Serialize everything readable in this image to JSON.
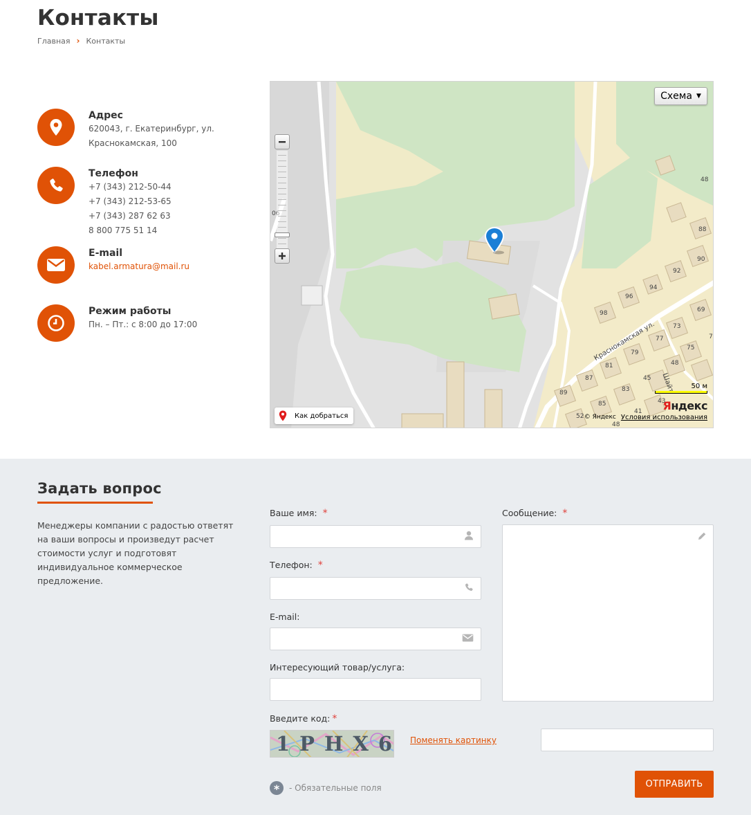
{
  "page": {
    "title": "Контакты",
    "breadcrumb": [
      "Главная",
      "Контакты"
    ]
  },
  "contacts": {
    "address": {
      "title": "Адрес",
      "lines": [
        "620043, г. Екатеринбург, ул.",
        "Краснокамская, 100"
      ],
      "icon": "map-pin-icon"
    },
    "phone": {
      "title": "Телефон",
      "lines": [
        "+7 (343) 212-50-44",
        "+7 (343) 212-53-65",
        "+7 (343) 287 62 63",
        "8 800 775 51 14"
      ],
      "icon": "phone-icon"
    },
    "email": {
      "title": "E-mail",
      "value": "kabel.armatura@mail.ru",
      "icon": "envelope-icon"
    },
    "hours": {
      "title": "Режим работы",
      "value": "Пн. – Пт.: с 8:00 до 17:00",
      "icon": "clock-icon"
    }
  },
  "map": {
    "type_button": "Схема",
    "route_button": "Как добраться",
    "copyright": "© Яндекс",
    "terms": "Условия использования",
    "logo_ya": "Я",
    "logo_rest": "ндекс",
    "scale_label": "50 м",
    "street": "Краснокамская ул.",
    "street2": "Шайт",
    "houses": [
      "48",
      "88",
      "90",
      "92",
      "94",
      "96",
      "98",
      "69",
      "73",
      "77",
      "75",
      "79",
      "81",
      "87",
      "89",
      "85",
      "83",
      "45",
      "43",
      "41",
      "48",
      "52",
      "48",
      "7",
      "06"
    ]
  },
  "form": {
    "section_title": "Задать вопрос",
    "intro": "Менеджеры компании с радостью ответят на ваши вопросы и произведут расчет стоимости услуг и подготовят индивидуальное коммерческое предложение.",
    "name_label": "Ваше имя:",
    "phone_label": "Телефон:",
    "email_label": "E-mail:",
    "product_label": "Интересующий товар/услуга:",
    "message_label": "Сообщение:",
    "captcha_label": "Введите код:",
    "captcha_text": "1PHX6",
    "change_picture": "Поменять картинку",
    "required_star": "*",
    "required_note": "- Обязательные поля",
    "submit": "ОТПРАВИТЬ"
  },
  "colors": {
    "accent": "#e05206",
    "section_bg": "#eaedf0"
  }
}
